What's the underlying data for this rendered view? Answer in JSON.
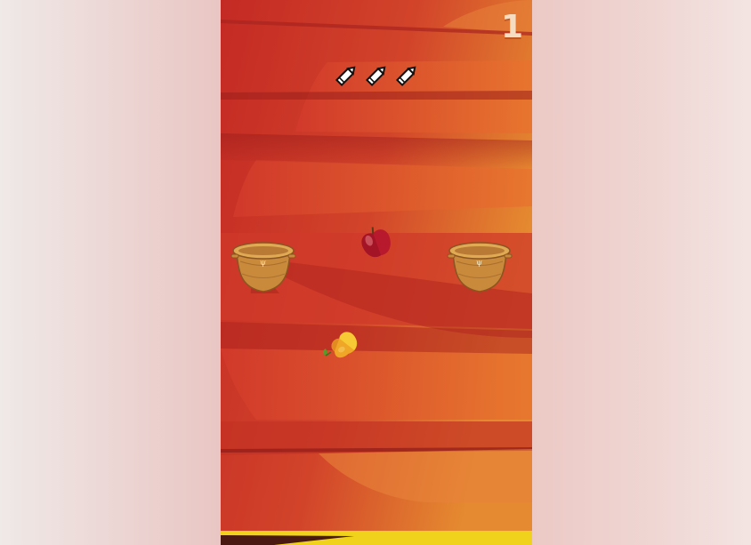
{
  "game": {
    "score": "1",
    "lives": [
      {
        "icon": "pencil-icon"
      },
      {
        "icon": "pencil-icon"
      },
      {
        "icon": "pencil-icon"
      }
    ],
    "baskets": [
      {
        "icon": "basket-icon",
        "side": "left"
      },
      {
        "icon": "basket-icon",
        "side": "right"
      }
    ],
    "fruits": [
      {
        "icon": "apple-icon",
        "kind": "apple"
      },
      {
        "icon": "pear-icon",
        "kind": "pear"
      }
    ]
  },
  "colors": {
    "background_red": "#c42a24",
    "accent_orange": "#e58a30",
    "score_text": "#f6dcc0",
    "bottom_bar": "#f0d21c"
  }
}
